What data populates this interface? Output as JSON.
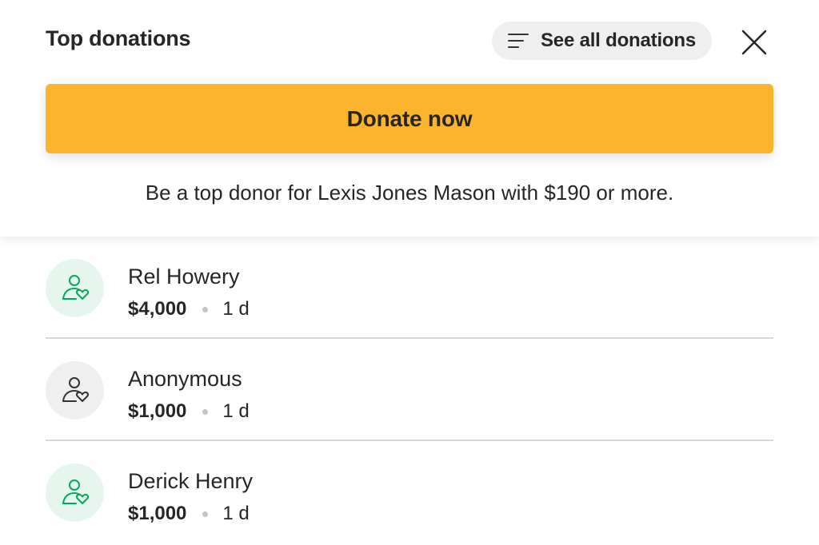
{
  "header": {
    "title": "Top donations",
    "see_all_label": "See all donations",
    "donate_label": "Donate now",
    "tagline": "Be a top donor for Lexis Jones Mason with $190 or more."
  },
  "icons": {
    "filter": "filter-lines-icon",
    "close": "close-icon",
    "donor": "person-heart-icon"
  },
  "colors": {
    "donate_button": "#fbb42d",
    "avatar_green_bg": "#e6f6ee",
    "avatar_green_icon": "#02a95c",
    "avatar_gray_bg": "#efefef",
    "avatar_gray_icon": "#333333"
  },
  "donations": [
    {
      "name": "Rel Howery",
      "amount": "$4,000",
      "time": "1 d",
      "style": "green"
    },
    {
      "name": "Anonymous",
      "amount": "$1,000",
      "time": "1 d",
      "style": "gray"
    },
    {
      "name": "Derick Henry",
      "amount": "$1,000",
      "time": "1 d",
      "style": "green"
    }
  ]
}
